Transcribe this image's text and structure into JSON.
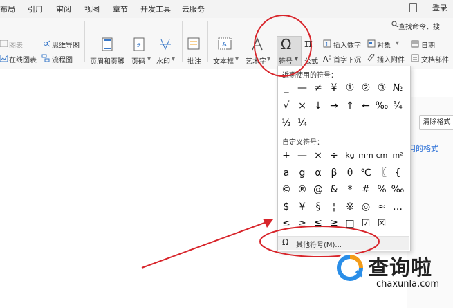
{
  "menu": {
    "items": [
      "布局",
      "引用",
      "审阅",
      "视图",
      "章节",
      "开发工具",
      "云服务"
    ],
    "search_text": "查找命令、搜",
    "login": "登录"
  },
  "ribbon": {
    "chart": "图表",
    "mindmap": "思维导图",
    "online_chart": "在线图表",
    "flowchart": "流程图",
    "header_footer": "页眉和页脚",
    "page_number": "页码",
    "watermark": "水印",
    "comment": "批注",
    "textbox": "文本框",
    "art_text": "艺术字",
    "symbol": "符号",
    "formula": "公式",
    "insert_number": "插入数字",
    "object": "对象",
    "drop_cap": "首字下沉",
    "insert_attachment": "插入附件",
    "date": "日期",
    "doc_parts": "文档部件"
  },
  "panel": {
    "clear_format": "清除格式",
    "style_link": "用的格式"
  },
  "symbol_menu": {
    "recent_title": "近期使用的符号：",
    "recent": [
      "_",
      "—",
      "≠",
      "¥",
      "①",
      "②",
      "③",
      "№",
      "√",
      "×",
      "↓",
      "→",
      "↑",
      "←",
      "‰",
      "¾",
      "½",
      "¼"
    ],
    "custom_title": "自定义符号：",
    "custom": [
      "+",
      "—",
      "×",
      "÷",
      "kg",
      "mm",
      "cm",
      "m²",
      "a",
      "g",
      "α",
      "β",
      "θ",
      "℃",
      "〖",
      "{",
      "©",
      "®",
      "@",
      "&",
      "*",
      "#",
      "%",
      "‰",
      "$",
      "￥",
      "§",
      "¦",
      "※",
      "◎",
      "≈",
      "…",
      "≤",
      "≥",
      "≦",
      "≧",
      "□",
      "☑",
      "☒"
    ],
    "more_symbols": "其他符号(M)..."
  },
  "watermark": {
    "brand": "查询啦",
    "url": "chaxunla.com"
  },
  "colors": {
    "annotation": "#d8252b",
    "brand_blue": "#2a8ee8",
    "brand_orange": "#f39c1a"
  }
}
